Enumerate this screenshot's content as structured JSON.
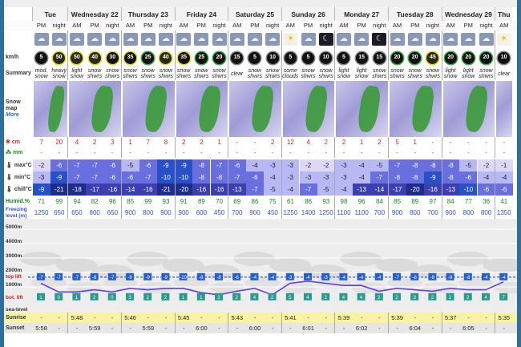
{
  "days": [
    {
      "name": "Tue",
      "span": 2
    },
    {
      "name": "Wednesday 22",
      "span": 3
    },
    {
      "name": "Thursday 23",
      "span": 3
    },
    {
      "name": "Friday 24",
      "span": 3
    },
    {
      "name": "Saturday 25",
      "span": 3
    },
    {
      "name": "Sunday 26",
      "span": 3
    },
    {
      "name": "Monday 27",
      "span": 3
    },
    {
      "name": "Tuesday 28",
      "span": 3
    },
    {
      "name": "Wednesday 29",
      "span": 3
    },
    {
      "name": "Thu",
      "span": 1
    }
  ],
  "periods": [
    "PM",
    "night",
    "AM",
    "PM",
    "night",
    "AM",
    "PM",
    "night",
    "AM",
    "PM",
    "night",
    "AM",
    "PM",
    "night",
    "AM",
    "PM",
    "night",
    "AM",
    "PM",
    "night",
    "AM",
    "PM",
    "night",
    "AM",
    "PM",
    "night",
    "AM"
  ],
  "labels": {
    "wind": "km/h",
    "summary": "Summary",
    "snowmap": "Snow map",
    "more": "More",
    "snow": "cm",
    "rain": "mm",
    "max": "max°C",
    "min": "min°C",
    "chill": "chill°C",
    "humid": "Humid.%",
    "freezing": "Freezing level (m)",
    "m5000": "5000m",
    "m4000": "4000m",
    "m3000": "3000m",
    "m2000": "2000m",
    "m1000": "1000m",
    "top": "top lift",
    "bot": "bot. lift",
    "sea": "sea-level",
    "sunrise": "Sunrise",
    "sunset": "Sunset"
  },
  "icons": [
    "snow-cloud",
    "snow-cloud",
    "snow-cloud",
    "snow-cloud",
    "snow-cloud",
    "snow-cloud",
    "snow-cloud",
    "snow-cloud",
    "snow-cloud",
    "snow-cloud",
    "snow-cloud",
    "snow-cloud",
    "snow-cloud",
    "snow-cloud",
    "sun",
    "snow-cloud",
    "night-clear",
    "snow-cloud",
    "snow-cloud",
    "night-clear",
    "snow-cloud",
    "snow-cloud",
    "snow-cloud",
    "snow-cloud",
    "snow-cloud",
    "snow-cloud",
    "sun"
  ],
  "wind": [
    "5",
    "50",
    "50",
    "40",
    "30",
    "35",
    "25",
    "40",
    "35",
    "25",
    "20",
    "15",
    "5",
    "10",
    "5",
    "5",
    "10",
    "5",
    "15",
    "15",
    "20",
    "20",
    "45",
    "20",
    "20",
    "20",
    "10"
  ],
  "summary": [
    "mod. snow",
    "heavy snow",
    "light snow",
    "snow shwrs",
    "snow shwrs",
    "snow shwrs",
    "snow shwrs",
    "snow shwrs",
    "snow shwrs",
    "snow shwrs",
    "snow shwrs",
    "clear",
    "snow shwrs",
    "snow shwrs",
    "some clouds",
    "snow shwrs",
    "snow shwrs",
    "light snow",
    "light snow",
    "snow shwrs",
    "snow shwrs",
    "snow shwrs",
    "snow shwrs",
    "light snow",
    "light snow",
    "snow shwrs",
    "clear"
  ],
  "snow": [
    "7",
    "20",
    "4",
    "2",
    "3",
    "1",
    "7",
    "8",
    "2",
    "2",
    "1",
    "-",
    "-",
    "2",
    "12",
    "4",
    "2",
    "2",
    "1",
    "2",
    "5",
    "1",
    "-",
    "-",
    "-",
    "-",
    "-"
  ],
  "rain": [
    "-",
    "-",
    "-",
    "-",
    "-",
    "-",
    "-",
    "-",
    "-",
    "-",
    "-",
    "-",
    "-",
    "-",
    "-",
    "-",
    "-",
    "-",
    "-",
    "-",
    "-",
    "-",
    "-",
    "-",
    "-",
    "-",
    "-"
  ],
  "max": [
    "-2",
    "-6",
    "-7",
    "-7",
    "-6",
    "-5",
    "-6",
    "-9",
    "-9",
    "-8",
    "-7",
    "-6",
    "-4",
    "-3",
    "-3",
    "-2",
    "-2",
    "-3",
    "-4",
    "-5",
    "-7",
    "-8",
    "-8",
    "-8",
    "-5",
    "-2",
    "-1"
  ],
  "min": [
    "-3",
    "-9",
    "-7",
    "-7",
    "-6",
    "-6",
    "-7",
    "-10",
    "-10",
    "-8",
    "-8",
    "-7",
    "-6",
    "-4",
    "-3",
    "-3",
    "-3",
    "-3",
    "-4",
    "-7",
    "-8",
    "-8",
    "-9",
    "-8",
    "-6",
    "-4",
    "-4"
  ],
  "chill": [
    "-9",
    "-21",
    "-18",
    "-17",
    "-16",
    "-14",
    "-16",
    "-21",
    "-20",
    "-16",
    "-16",
    "-13",
    "-7",
    "-5",
    "-4",
    "-7",
    "-5",
    "-4",
    "-13",
    "-14",
    "-17",
    "-20",
    "-16",
    "-13",
    "-10",
    "-6",
    "-6"
  ],
  "humid": [
    "71",
    "99",
    "94",
    "82",
    "96",
    "85",
    "99",
    "93",
    "91",
    "89",
    "70",
    "69",
    "86",
    "75",
    "61",
    "86",
    "93",
    "98",
    "96",
    "84",
    "85",
    "89",
    "97",
    "84",
    "77",
    "36",
    "41"
  ],
  "freezing": [
    "1250",
    "650",
    "650",
    "800",
    "650",
    "900",
    "800",
    "900",
    "900",
    "600",
    "450",
    "700",
    "900",
    "450",
    "1250",
    "1400",
    "1250",
    "1100",
    "1100",
    "700",
    "900",
    "800",
    "700",
    "900",
    "800",
    "800",
    "1350"
  ],
  "top_lift": [
    "-7",
    "-7",
    "-7",
    "-8",
    "-7",
    "-9",
    "-9",
    "-9",
    "-10",
    "-8",
    "-8",
    "-6",
    "-4",
    "-4",
    "-3",
    "-4",
    "-3",
    "-4",
    "-4",
    "-4",
    "-7",
    "-8",
    "-8",
    "-9",
    "-8",
    "-4",
    "-4"
  ],
  "bot_lift": [
    "1",
    "0",
    "1",
    "2",
    "0",
    "3",
    "2",
    "2",
    "1",
    "1",
    "2",
    "2",
    "4",
    "2",
    "5",
    "4",
    "2",
    "4",
    "4",
    "2",
    "2",
    "3",
    "2",
    "2",
    "2",
    "4",
    "7"
  ],
  "sunrise": [
    "-",
    "-",
    "5:48",
    "-",
    "-",
    "5:46",
    "-",
    "-",
    "5:45",
    "-",
    "-",
    "5:43",
    "-",
    "-",
    "5:41",
    "-",
    "-",
    "5:39",
    "-",
    "-",
    "5:39",
    "-",
    "-",
    "5:37",
    "-",
    "-",
    "5:35"
  ],
  "sunset": [
    "5:58",
    "-",
    "-",
    "5:59",
    "-",
    "-",
    "5:59",
    "-",
    "-",
    "6:00",
    "-",
    "-",
    "6:00",
    "-",
    "-",
    "6:01",
    "-",
    "-",
    "6:02",
    "-",
    "-",
    "6:04",
    "-",
    "-",
    "6:05",
    "-",
    "-"
  ],
  "colors": {
    "frame": "#2f6fa0",
    "temp_blue": "#2850c8",
    "temp_dark": "#1e2d8a",
    "temp_mid": "#6a6fe0",
    "temp_light": "#b8b8f5",
    "temp_faint": "#ddd8f7",
    "snow_red": "#d42020",
    "humid_green": "#1a8a20",
    "freezing_blue": "#3050c0",
    "freezing_line": "#6040e0",
    "sunrise_bg": "#f7f3a0"
  }
}
